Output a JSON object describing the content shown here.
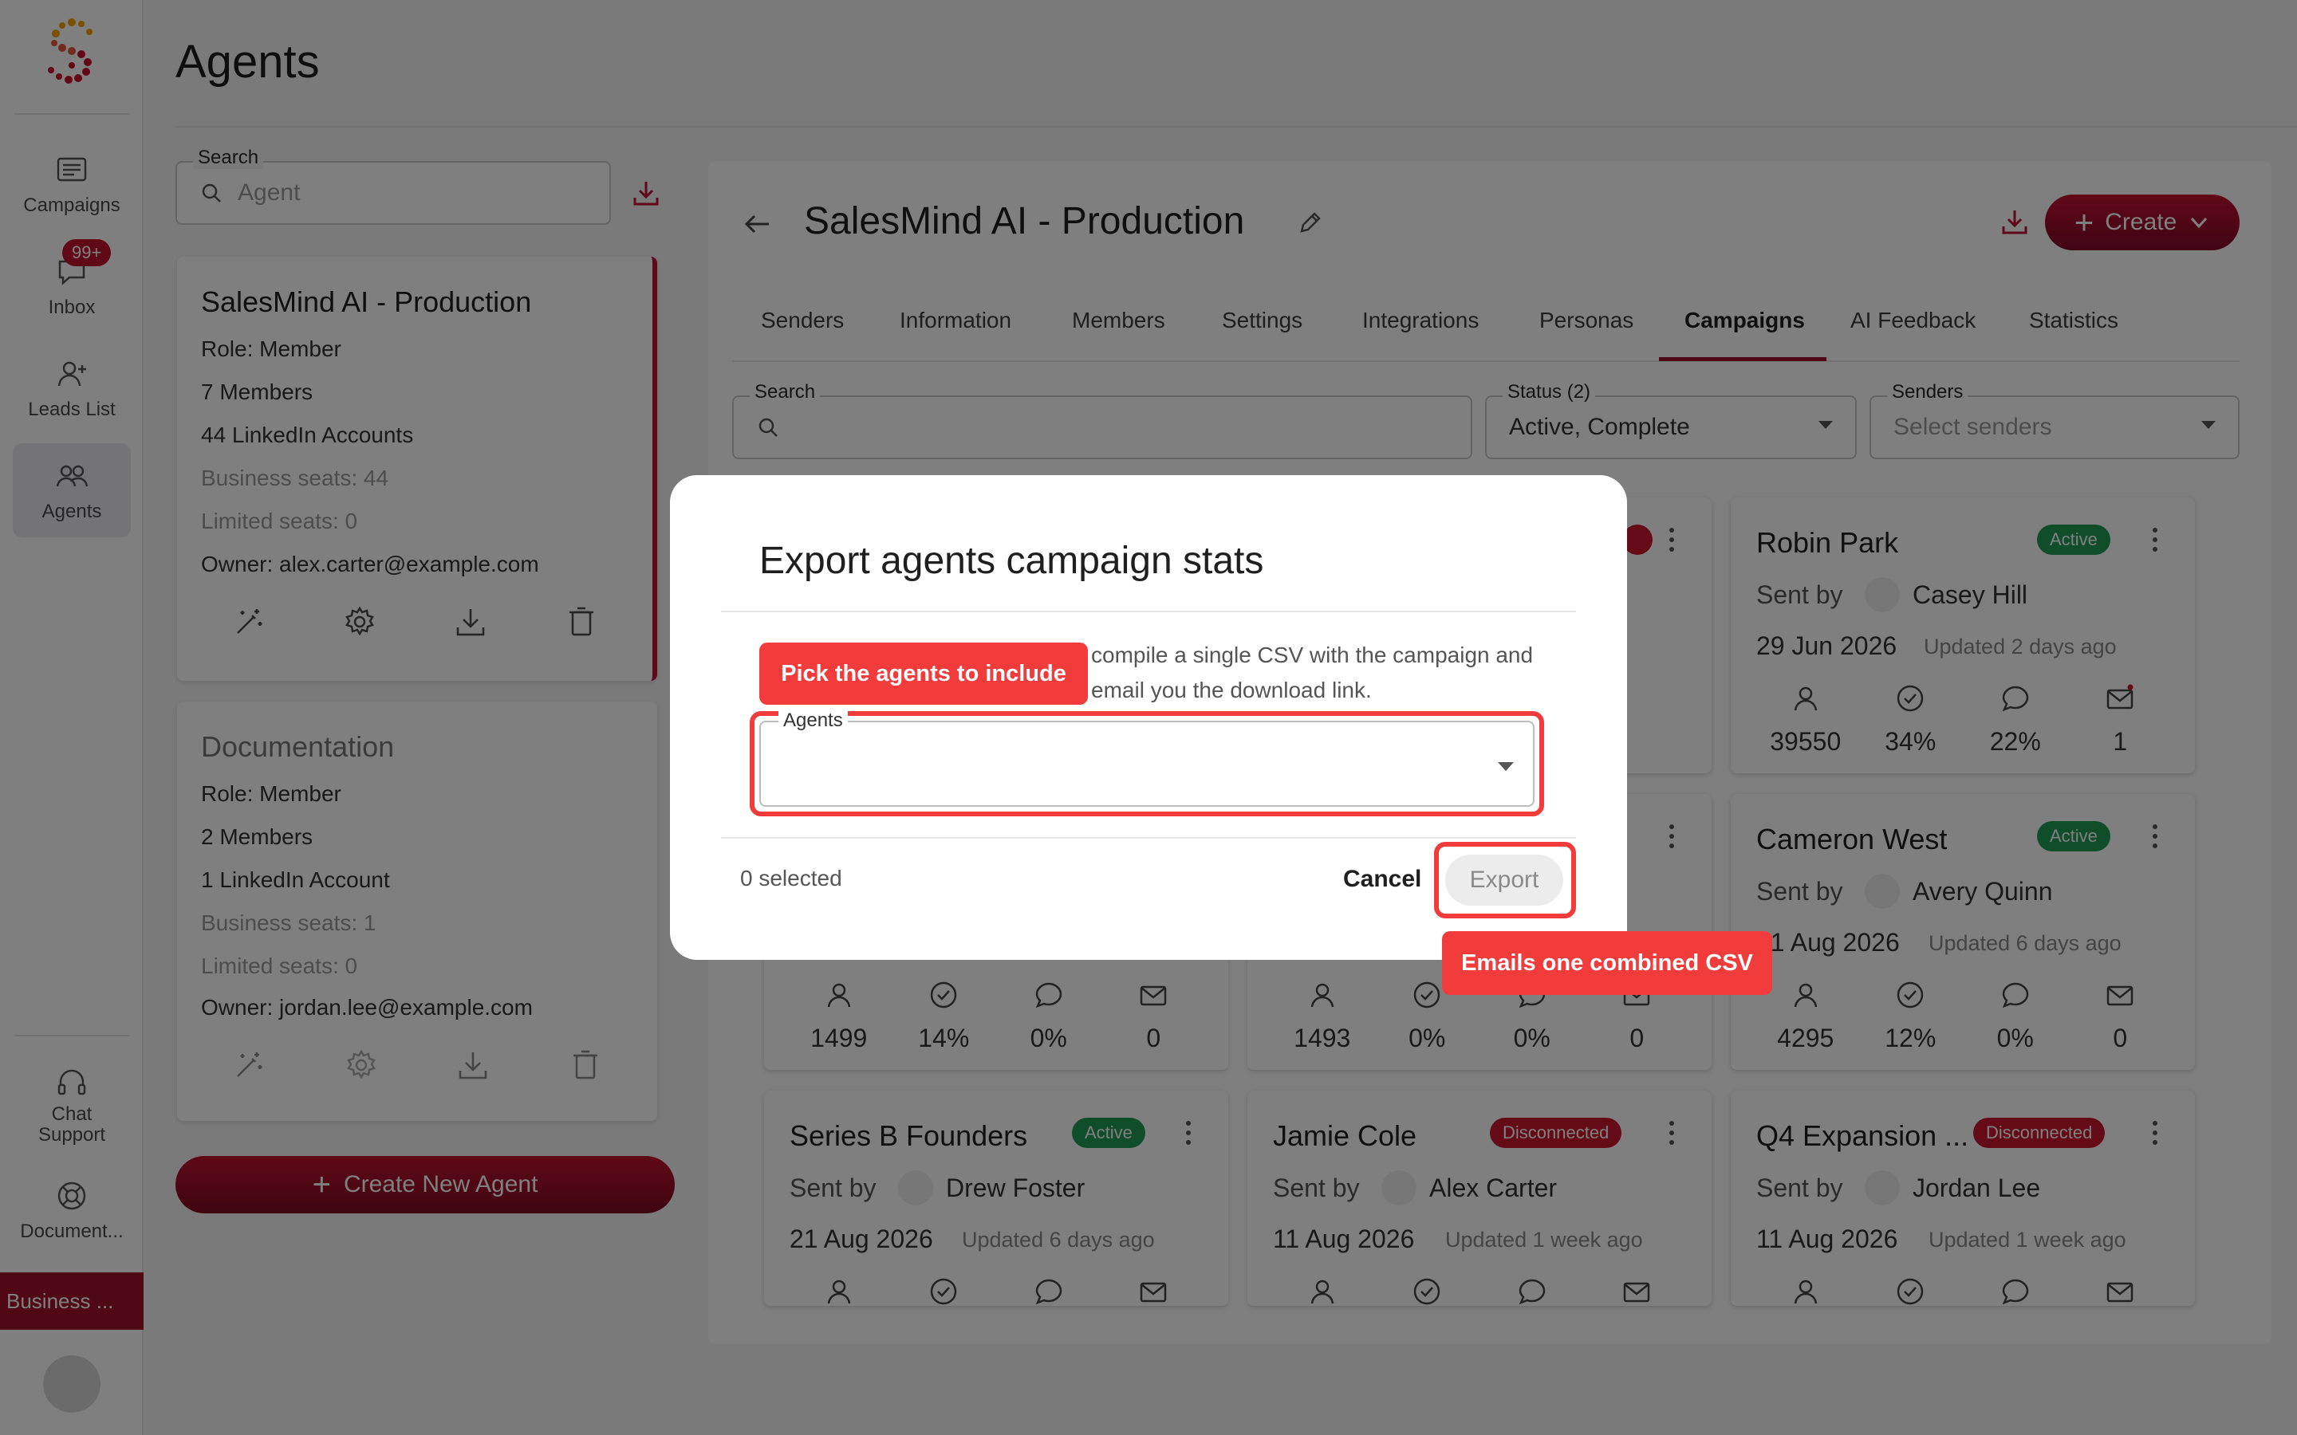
{
  "sidebar": {
    "items": [
      {
        "label": "Campaigns",
        "icon": "campaigns-icon"
      },
      {
        "label": "Inbox",
        "icon": "inbox-icon",
        "badge": "99+"
      },
      {
        "label": "Leads List",
        "icon": "add-user-icon"
      },
      {
        "label": "Agents",
        "icon": "agents-icon"
      }
    ],
    "chat_support": {
      "line1": "Chat",
      "line2": "Support"
    },
    "documentation": "Document...",
    "business": "Business ..."
  },
  "header": {
    "title": "Agents"
  },
  "agents_panel": {
    "search_label": "Search",
    "search_placeholder": "Agent",
    "agents": [
      {
        "name": "SalesMind AI - Production",
        "role": "Role: Member",
        "members": "7 Members",
        "accounts": "44 LinkedIn Accounts",
        "business_seats": "Business seats: 44",
        "limited_seats": "Limited seats: 0",
        "owner": "Owner: alex.carter@example.com"
      },
      {
        "name": "Documentation",
        "role": "Role: Member",
        "members": "2 Members",
        "accounts": "1 LinkedIn Account",
        "business_seats": "Business seats: 1",
        "limited_seats": "Limited seats: 0",
        "owner": "Owner: jordan.lee@example.com"
      }
    ],
    "create_label": "Create New Agent"
  },
  "main": {
    "agent_title": "SalesMind AI - Production",
    "create_label": "Create",
    "tabs": [
      "Senders",
      "Information",
      "Members",
      "Settings",
      "Integrations",
      "Personas",
      "Campaigns",
      "AI Feedback",
      "Statistics"
    ],
    "active_tab": "Campaigns",
    "filters": {
      "search_label": "Search",
      "status_label": "Status (2)",
      "status_value": "Active, Complete",
      "senders_label": "Senders",
      "senders_placeholder": "Select senders"
    },
    "campaigns": [
      {
        "name": "Robin Park",
        "status": "Active",
        "sender": "Casey Hill",
        "date": "29 Jun 2026",
        "updated": "Updated 2 days ago",
        "stats": [
          "39550",
          "34%",
          "22%",
          "1"
        ]
      },
      {
        "name": "Cameron West",
        "status": "Active",
        "sender": "Avery Quinn",
        "date": "21 Aug 2026",
        "updated": "Updated 6 days ago",
        "stats": [
          "4295",
          "12%",
          "0%",
          "0"
        ]
      },
      {
        "stats": [
          "1499",
          "14%",
          "0%",
          "0"
        ]
      },
      {
        "stats": [
          "1493",
          "0%",
          "0%",
          "0"
        ]
      },
      {
        "name": "Series B Founders",
        "status": "Active",
        "sender": "Drew Foster",
        "date": "21 Aug 2026",
        "updated": "Updated 6 days ago"
      },
      {
        "name": "Jamie Cole",
        "status": "Disconnected",
        "sender": "Alex Carter",
        "date": "11 Aug 2026",
        "updated": "Updated 1 week ago"
      },
      {
        "name": "Q4 Expansion ...",
        "status": "Disconnected",
        "sender": "Jordan Lee",
        "date": "11 Aug 2026",
        "updated": "Updated 1 week ago"
      }
    ],
    "sent_by": "Sent by"
  },
  "modal": {
    "title": "Export agents campaign stats",
    "description": "compile a single CSV with the campaign and email you the download link.",
    "agents_label": "Agents",
    "selected_count": "0 selected",
    "cancel_label": "Cancel",
    "export_label": "Export"
  },
  "callouts": {
    "pick_agents": "Pick the agents to include",
    "emails_csv": "Emails one combined CSV"
  },
  "colors": {
    "brand": "#a3102b",
    "active": "#1f9b57",
    "disconnected": "#c8172f",
    "highlight": "#f23b3b"
  }
}
